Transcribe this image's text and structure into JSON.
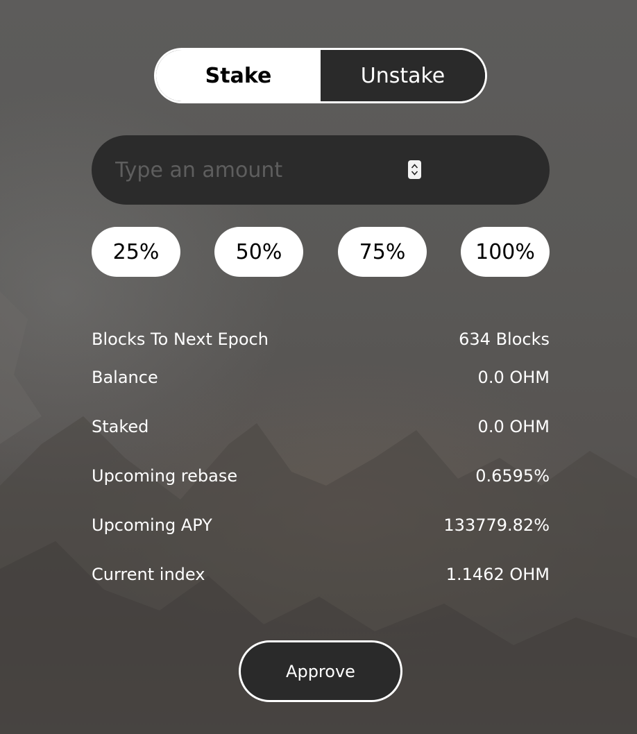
{
  "tabs": {
    "stake_label": "Stake",
    "unstake_label": "Unstake",
    "active": "Stake"
  },
  "amount": {
    "placeholder": "Type an amount",
    "value": ""
  },
  "percent_buttons": [
    "25%",
    "50%",
    "75%",
    "100%"
  ],
  "info": [
    {
      "label": "Blocks To Next Epoch",
      "value": "634 Blocks"
    },
    {
      "label": "Balance",
      "value": "0.0 OHM"
    },
    {
      "label": "Staked",
      "value": "0.0 OHM"
    },
    {
      "label": "Upcoming rebase",
      "value": "0.6595%"
    },
    {
      "label": "Upcoming APY",
      "value": "133779.82%"
    },
    {
      "label": "Current index",
      "value": "1.1462 OHM"
    }
  ],
  "approve_label": "Approve",
  "icons": {
    "spinner": "number-stepper-icon"
  },
  "colors": {
    "background": "#5a5957",
    "panel": "#2b2b2b",
    "accent": "#ffffff"
  }
}
